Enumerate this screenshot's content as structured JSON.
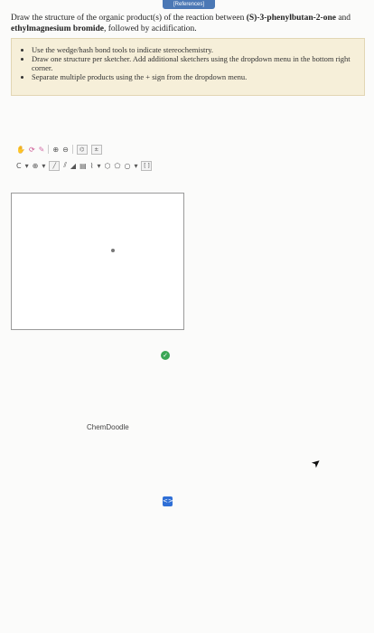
{
  "references_tab": "[References]",
  "question": {
    "part1": "Draw the structure of the organic product(s) of the reaction between ",
    "reagent1": "(S)-3-phenylbutan-2-one",
    "part2": " and ",
    "reagent2": "ethylmagnesium bromide",
    "part3": ", followed by acidification."
  },
  "instructions": [
    "Use the wedge/hash bond tools to indicate stereochemistry.",
    "Draw one structure per sketcher. Add additional sketchers using the dropdown menu in the bottom right corner.",
    "Separate multiple products using the + sign from the dropdown menu."
  ],
  "toolbar": {
    "row1_icons": [
      "hand-icon",
      "lasso-icon",
      "eraser-icon",
      "zoom-in-icon",
      "zoom-out-icon",
      "template-icon",
      "charge-icon"
    ],
    "row2_icons": [
      "atom-icon",
      "bond-icon",
      "wedge-icon",
      "hash-icon",
      "chain-icon",
      "ring-icon"
    ],
    "charge_label": "± ",
    "ring_label": "[ ]"
  },
  "watermark": "ChemDoodle",
  "check_symbol": "✓",
  "dropdown_symbol": "<>",
  "colors": {
    "accent": "#4b78b5",
    "instructions_bg": "#f6efd9",
    "check": "#3aa655",
    "dropdown": "#2f6fd6"
  }
}
